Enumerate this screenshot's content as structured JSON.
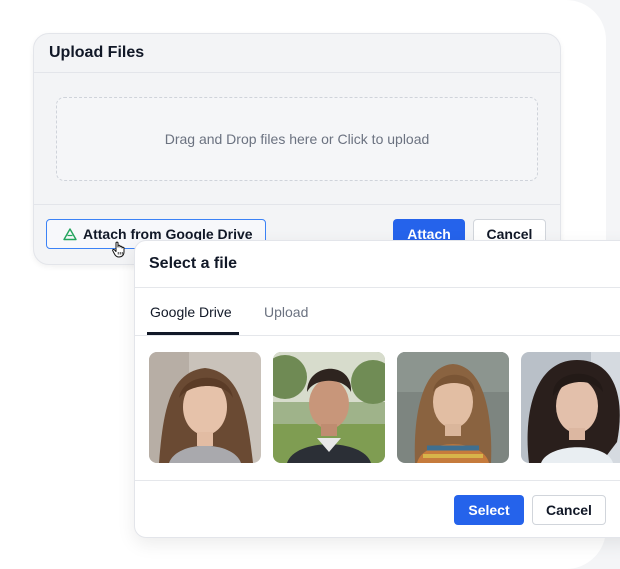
{
  "upload_dialog": {
    "title": "Upload Files",
    "dropzone_text": "Drag and Drop files here or Click to upload",
    "gdrive_button": "Attach from Google Drive",
    "attach_button": "Attach",
    "cancel_button": "Cancel"
  },
  "select_dialog": {
    "title": "Select a file",
    "tabs": [
      {
        "label": "Google Drive",
        "active": true
      },
      {
        "label": "Upload",
        "active": false
      }
    ],
    "photos": [
      {
        "name": "photo-woman-long-hair"
      },
      {
        "name": "photo-young-man-outdoors"
      },
      {
        "name": "photo-woman-colorful-sweater"
      },
      {
        "name": "photo-woman-dark-curly-hair"
      }
    ],
    "select_button": "Select",
    "cancel_button": "Cancel"
  },
  "colors": {
    "primary": "#2563eb",
    "focus_border": "#3b82f6",
    "drive_icon": "#22a45d"
  }
}
